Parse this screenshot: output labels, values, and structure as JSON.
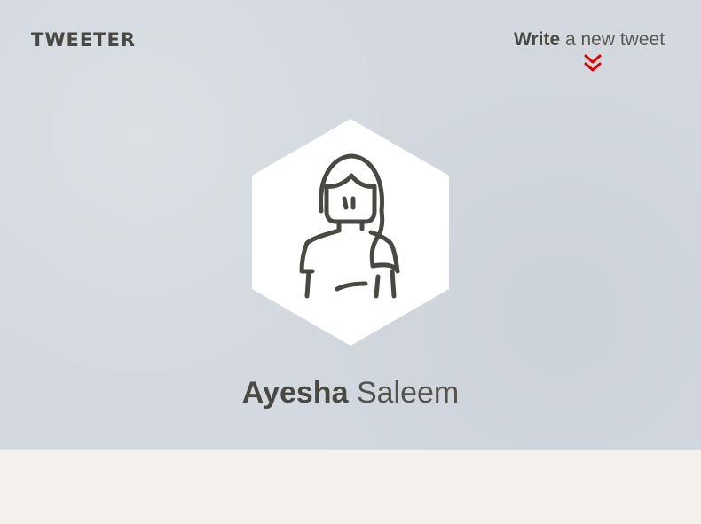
{
  "brand": {
    "logo": "TWEETER"
  },
  "compose": {
    "strong": "Write",
    "rest": " a new tweet",
    "icon": "double-chevron-down-icon"
  },
  "profile": {
    "avatar_icon": "user-avatar-icon",
    "first_name": "Ayesha",
    "last_name": "Saleem"
  },
  "colors": {
    "header_bg": "#d3d9df",
    "text": "#4a4843",
    "accent": "#e00000",
    "page_bg": "#f4f1ec",
    "hex_fill": "#ffffff"
  }
}
